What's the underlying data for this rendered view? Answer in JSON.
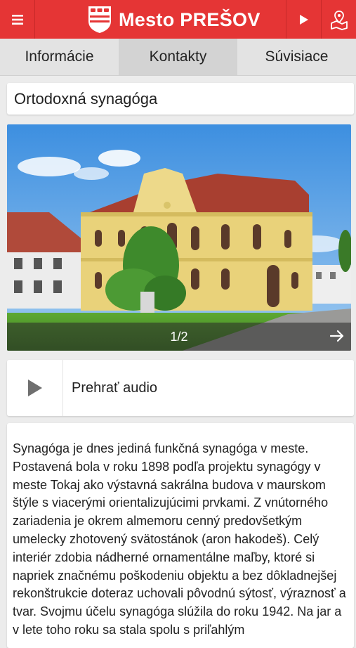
{
  "header": {
    "title": "Mesto PREŠOV",
    "menu_icon": "hamburger-menu-icon",
    "play_icon": "play-icon",
    "map_icon": "map-marker-icon",
    "brand_color": "#e53535"
  },
  "tabs": [
    {
      "label": "Informácie"
    },
    {
      "label": "Kontakty"
    },
    {
      "label": "Súvisiace"
    }
  ],
  "place": {
    "title": "Ortodoxná synagóga"
  },
  "gallery": {
    "counter": "1/2",
    "next_icon": "arrow-right-icon"
  },
  "audio": {
    "label": "Prehrať audio"
  },
  "description": {
    "text": "Synagóga je dnes jediná funkčná synagóga v meste. Postavená bola v roku 1898 podľa projektu synagógy v meste Tokaj ako výstavná sakrálna budova v maurskom štýle s viacerými orientalizujúcimi prvkami. Z vnútorného zariadenia je okrem almemoru cenný predovšetkým umelecky zhotovený svätostánok (aron hakodeš). Celý interiér zdobia nádherné ornamentálne maľby, ktoré si napriek značnému poškodeniu objektu a bez dôkladnejšej rekonštrukcie doteraz uchovali pôvodnú sýtosť, výraznosť a tvar. Svojmu účelu synagóga slúžila do roku 1942. Na jar a v lete toho roku sa stala spolu s priľahlým"
  }
}
